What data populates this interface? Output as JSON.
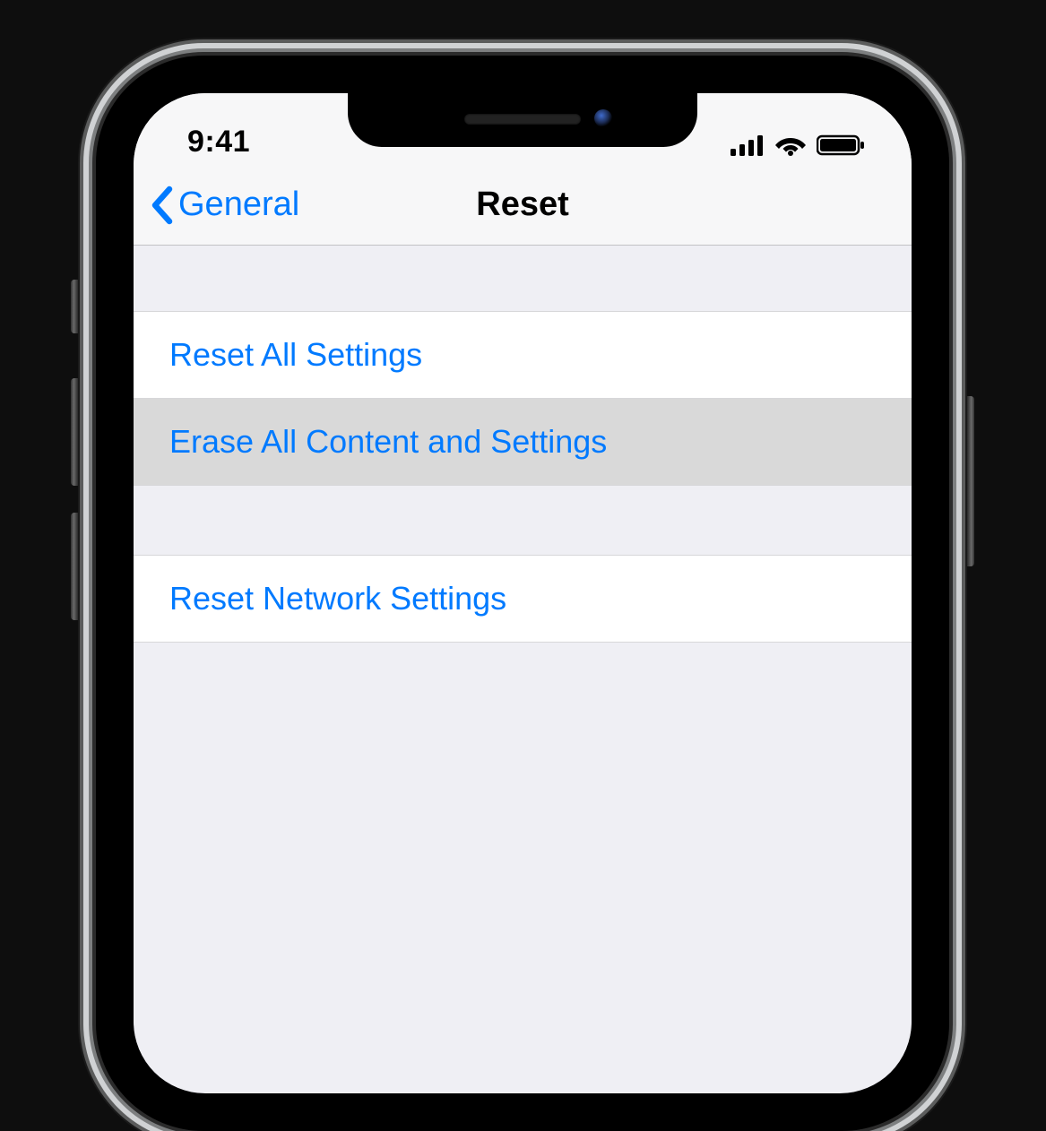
{
  "status": {
    "time": "9:41"
  },
  "nav": {
    "back_label": "General",
    "title": "Reset"
  },
  "groups": [
    {
      "rows": [
        {
          "label": "Reset All Settings",
          "selected": false
        },
        {
          "label": "Erase All Content and Settings",
          "selected": true
        }
      ]
    },
    {
      "rows": [
        {
          "label": "Reset Network Settings",
          "selected": false
        }
      ]
    }
  ],
  "colors": {
    "link": "#007aff",
    "background": "#efeff4",
    "row": "#ffffff"
  }
}
